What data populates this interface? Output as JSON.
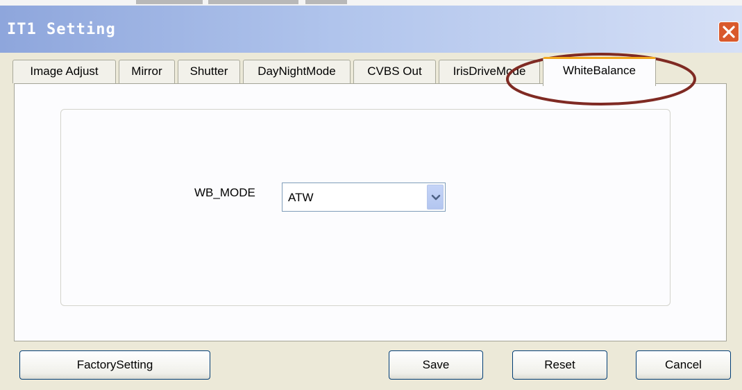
{
  "window": {
    "title": "IT1 Setting"
  },
  "tabs": [
    {
      "label": "Image Adjust"
    },
    {
      "label": "Mirror"
    },
    {
      "label": "Shutter"
    },
    {
      "label": "DayNightMode"
    },
    {
      "label": "CVBS Out"
    },
    {
      "label": "IrisDriveMode"
    },
    {
      "label": "WhiteBalance",
      "selected": true
    }
  ],
  "white_balance": {
    "mode_label": "WB_MODE",
    "mode_value": "ATW"
  },
  "buttons": {
    "factory_setting": "FactorySetting",
    "save": "Save",
    "reset": "Reset",
    "cancel": "Cancel"
  },
  "icons": {
    "close": "close-icon",
    "dropdown": "chevron-down-icon"
  },
  "colors": {
    "title_bar_start": "#8ea6dc",
    "title_bar_end": "#d6e0f6",
    "close_button": "#d9592c",
    "active_tab_accent": "#f1a81f",
    "annotation_ellipse": "#7f2a23"
  }
}
